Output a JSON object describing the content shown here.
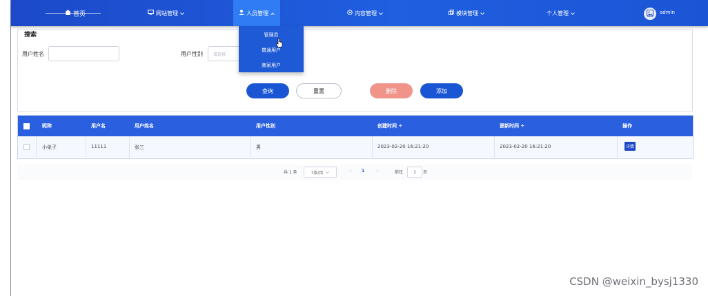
{
  "nav": {
    "home": {
      "label": "首页",
      "icon": "home-icon"
    },
    "items": [
      {
        "label": "网站管理",
        "icon": "monitor-icon"
      },
      {
        "label": "人员管理",
        "icon": "user-icon"
      },
      {
        "label": "内容管理",
        "icon": "gear-icon"
      },
      {
        "label": "模块管理",
        "icon": "copy-icon"
      },
      {
        "label": "个人管理",
        "icon": ""
      }
    ],
    "user_name": "admin"
  },
  "dropdown": {
    "items": [
      "管理员",
      "普通用户",
      "商家用户"
    ]
  },
  "search": {
    "legend": "搜索",
    "name_label": "用户姓名",
    "name_value": "",
    "gender_label": "用户性别",
    "gender_placeholder": "请选择",
    "query_label": "查询",
    "reset_label": "重置",
    "delete_label": "删除",
    "add_label": "添加"
  },
  "table": {
    "headers": [
      "昵称",
      "用户名",
      "用户姓名",
      "用户性别",
      "创建时间 ÷",
      "更新时间 ÷",
      "操作"
    ],
    "rows": [
      {
        "nickname": "小张子",
        "username": "11111",
        "real_name": "张三",
        "gender": "男",
        "created": "2023-02-20 16:21:20",
        "updated": "2023-02-20 16:21:20",
        "action": "详情"
      }
    ]
  },
  "pagination": {
    "total": "共 1 条",
    "page_size": "7条/页",
    "current_page": "1",
    "goto_label": "前往",
    "goto_value": "1",
    "page_unit": "页"
  },
  "watermark": "CSDN @weixin_bysj1330",
  "colors": {
    "nav": "#1f5fe0",
    "primary": "#1a56d3",
    "danger": "#f0948a",
    "table_header": "#2a5fe0"
  }
}
